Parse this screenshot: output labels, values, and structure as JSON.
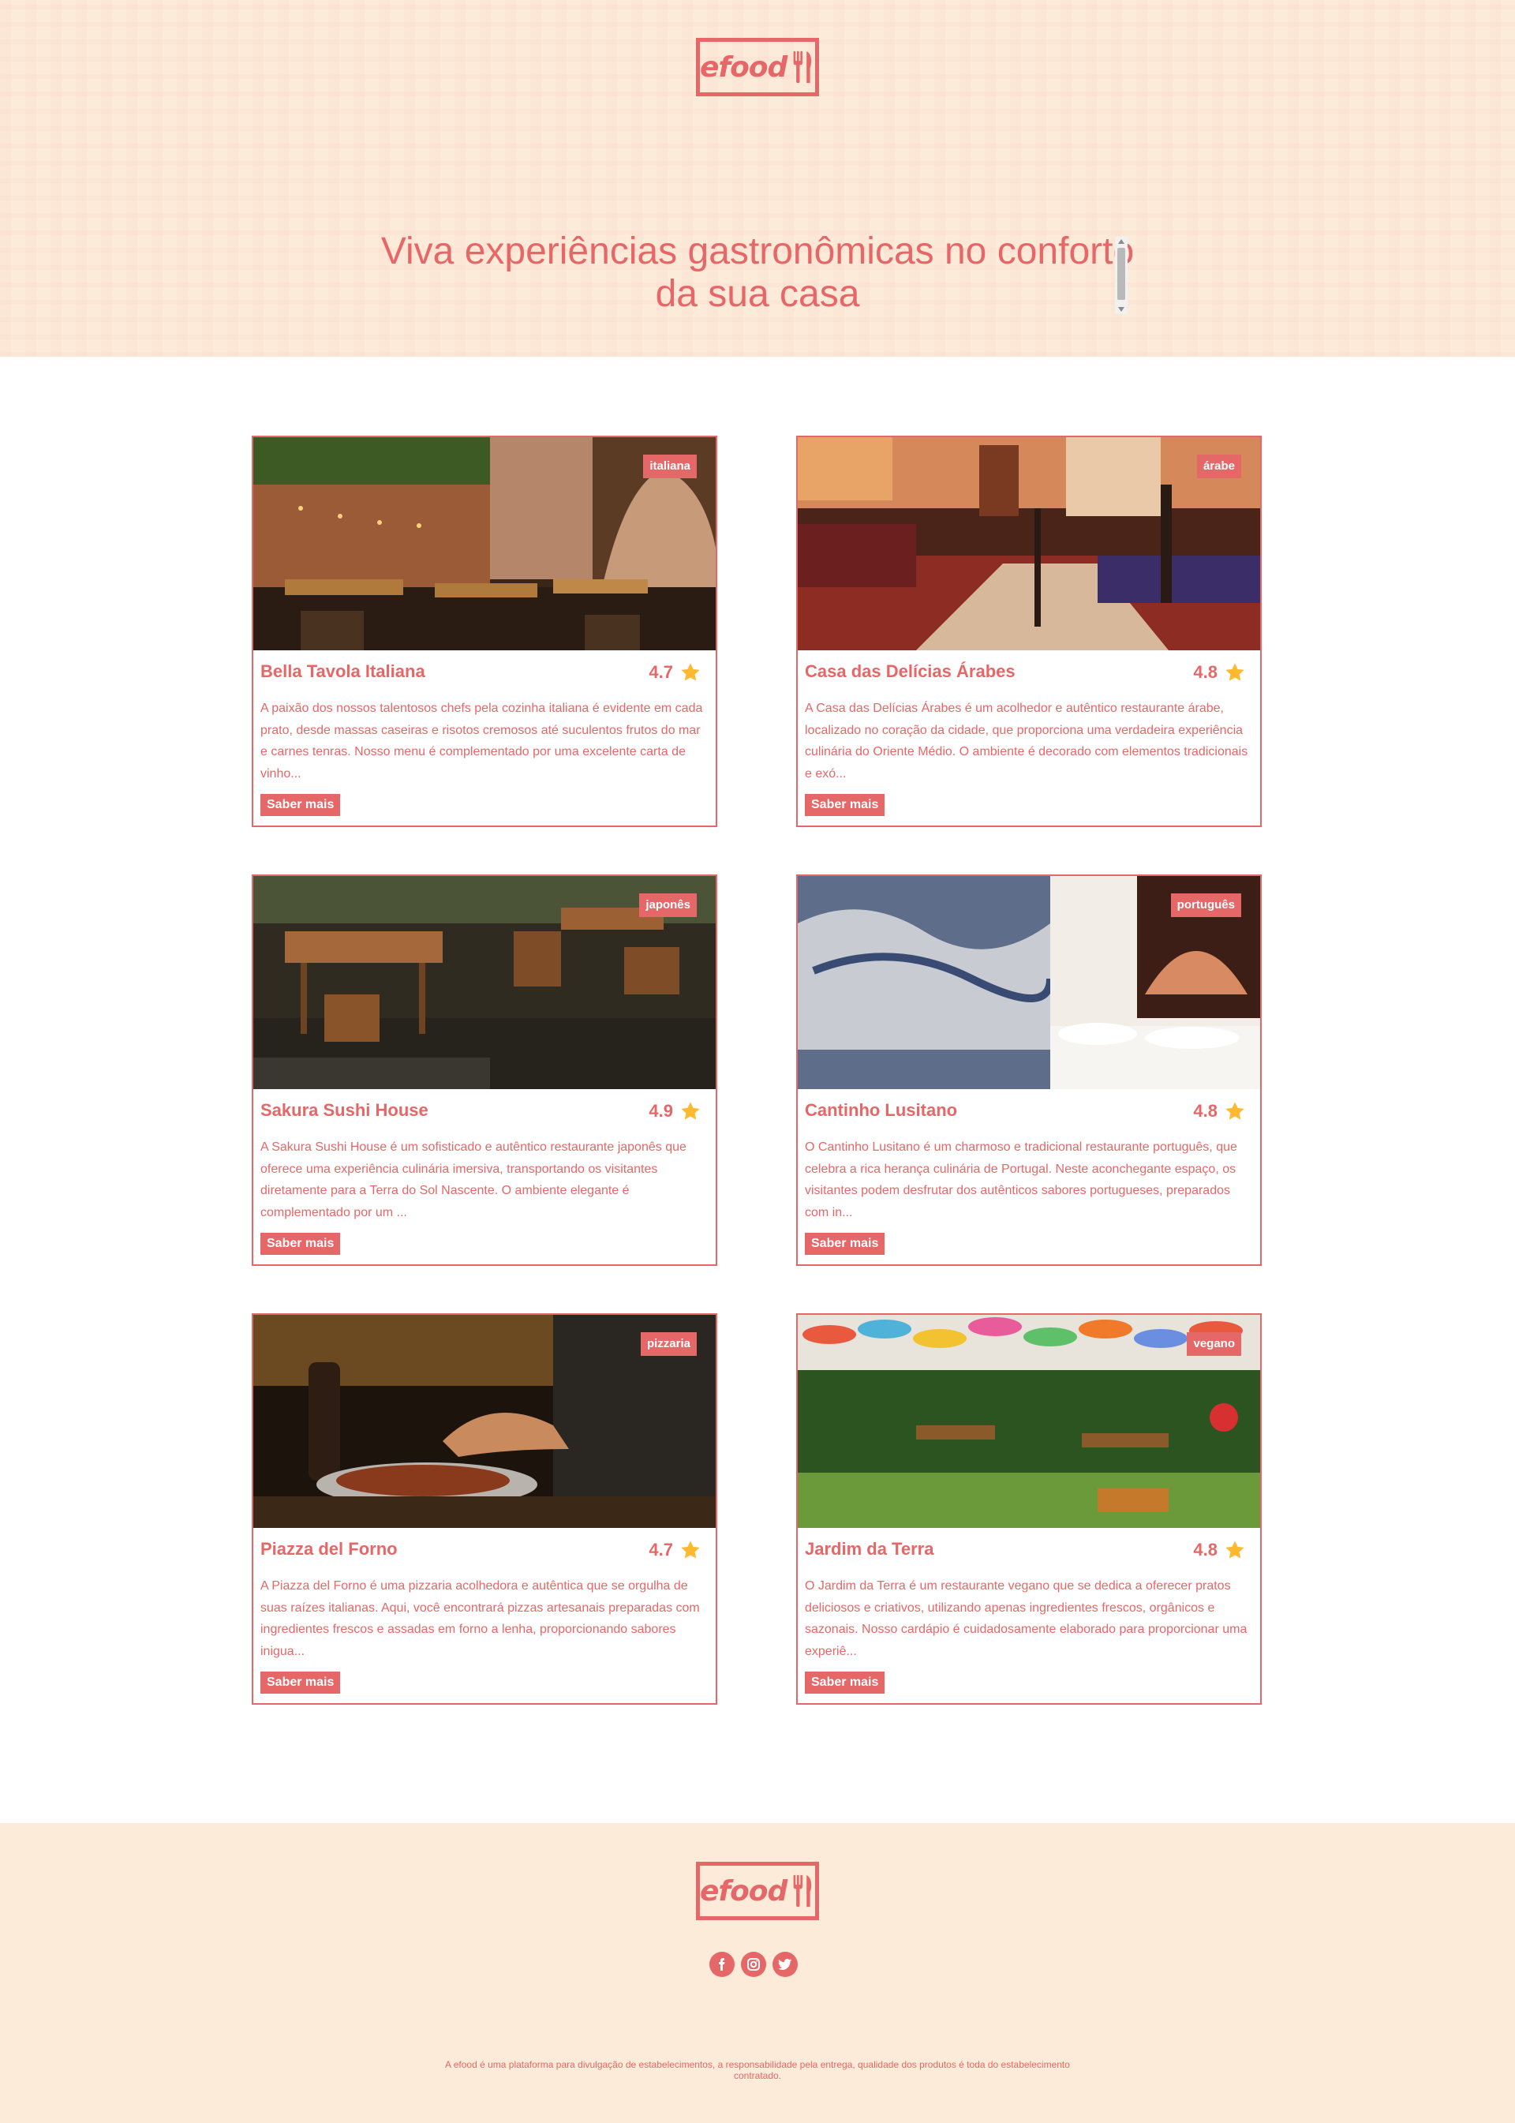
{
  "brand": {
    "name": "efood",
    "accent": "#e66767",
    "background": "#fdebd9"
  },
  "hero": {
    "title": "Viva experiências gastronômicas no conforto da sua casa"
  },
  "restaurants": [
    {
      "tag": "italiana",
      "name": "Bella Tavola Italiana",
      "rating": "4.7",
      "description": "A paixão dos nossos talentosos chefs pela cozinha italiana é evidente em cada prato, desde massas caseiras e risotos cremosos até suculentos frutos do mar e carnes tenras. Nosso menu é complementado por uma excelente carta de vinho...",
      "button": "Saber mais"
    },
    {
      "tag": "árabe",
      "name": "Casa das Delícias Árabes",
      "rating": "4.8",
      "description": "A Casa das Delícias Árabes é um acolhedor e autêntico restaurante árabe, localizado no coração da cidade, que proporciona uma verdadeira experiência culinária do Oriente Médio. O ambiente é decorado com elementos tradicionais e exó...",
      "button": "Saber mais"
    },
    {
      "tag": "japonês",
      "name": "Sakura Sushi House",
      "rating": "4.9",
      "description": "A Sakura Sushi House é um sofisticado e autêntico restaurante japonês que oferece uma experiência culinária imersiva, transportando os visitantes diretamente para a Terra do Sol Nascente. O ambiente elegante é complementado por um ...",
      "button": "Saber mais"
    },
    {
      "tag": "português",
      "name": "Cantinho Lusitano",
      "rating": "4.8",
      "description": "O Cantinho Lusitano é um charmoso e tradicional restaurante português, que celebra a rica herança culinária de Portugal. Neste aconchegante espaço, os visitantes podem desfrutar dos autênticos sabores portugueses, preparados com in...",
      "button": "Saber mais"
    },
    {
      "tag": "pizzaria",
      "name": "Piazza del Forno",
      "rating": "4.7",
      "description": "A Piazza del Forno é uma pizzaria acolhedora e autêntica que se orgulha de suas raízes italianas. Aqui, você encontrará pizzas artesanais preparadas com ingredientes frescos e assadas em forno a lenha, proporcionando sabores inigua...",
      "button": "Saber mais"
    },
    {
      "tag": "vegano",
      "name": "Jardim da Terra",
      "rating": "4.8",
      "description": "O Jardim da Terra é um restaurante vegano que se dedica a oferecer pratos deliciosos e criativos, utilizando apenas ingredientes frescos, orgânicos e sazonais. Nosso cardápio é cuidadosamente elaborado para proporcionar uma experiê...",
      "button": "Saber mais"
    }
  ],
  "footer": {
    "social": [
      "facebook-icon",
      "instagram-icon",
      "twitter-icon"
    ],
    "note": "A efood é uma plataforma para divulgação de estabelecimentos, a responsabilidade pela entrega, qualidade dos produtos é toda do estabelecimento contratado."
  }
}
